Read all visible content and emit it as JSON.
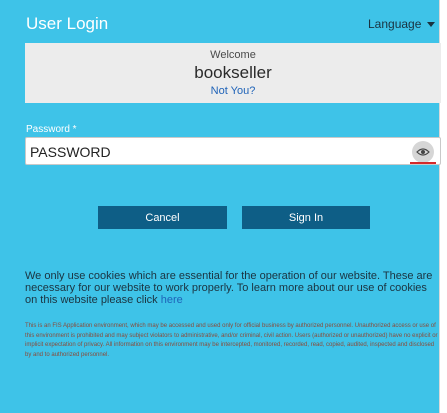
{
  "header": {
    "title": "User Login",
    "language_label": "Language"
  },
  "welcome": {
    "label": "Welcome",
    "username": "bookseller",
    "not_you": "Not You?"
  },
  "password": {
    "label": "Password *",
    "value": "PASSWORD",
    "toggle_icon": "eye-icon"
  },
  "buttons": {
    "cancel": "Cancel",
    "sign_in": "Sign In"
  },
  "cookie_notice": {
    "text": "We only use cookies which are essential for the operation of our website. These are necessary for our website to work properly. To learn more about our use of cookies on this website please click ",
    "link": "here"
  },
  "disclaimer": "This is an FIS Application environment, which may be accessed and used only for official business by authorized personnel. Unauthorized access or use of this environment is prohibited and may subject violators to administrative, and/or criminal, civil action. Users (authorized or unauthorized) have no explicit or implicit expectation of privacy. All information on this environment may be intercepted, monitored, recorded, read, copied, audited, inspected and disclosed by and to authorized personnel.",
  "colors": {
    "background": "#3ec3e8",
    "button": "#0e5e86",
    "link": "#1f63b8",
    "accent_red": "#d52a2a"
  }
}
